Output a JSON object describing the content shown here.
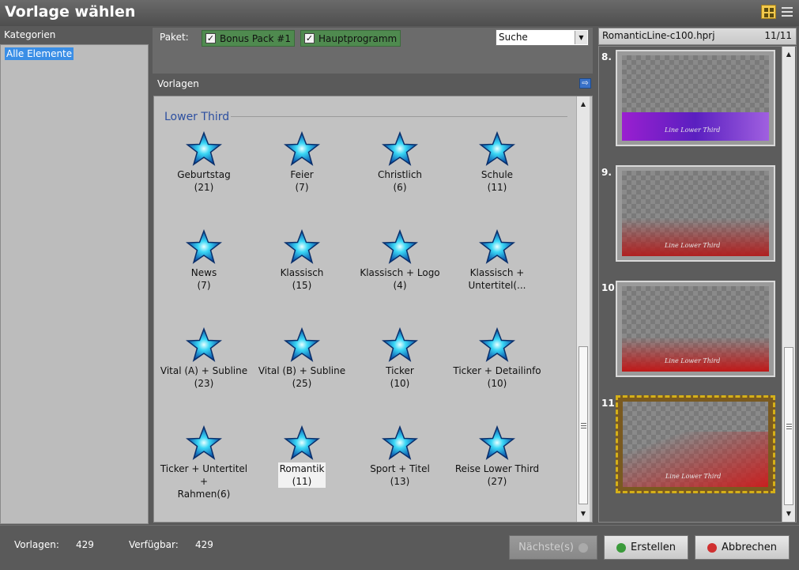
{
  "window": {
    "title": "Vorlage wählen"
  },
  "view_toggle": {
    "grid_icon": "grid-view-icon",
    "list_icon": "list-view-icon"
  },
  "categories": {
    "header": "Kategorien",
    "items": [
      {
        "label": "Alle Elemente",
        "selected": true
      }
    ]
  },
  "filter": {
    "paket_label": "Paket:",
    "packages": [
      {
        "label": "Bonus Pack #1",
        "checked": true
      },
      {
        "label": "Hauptprogramm",
        "checked": true
      }
    ],
    "search_value": "Suche"
  },
  "templates": {
    "header": "Vorlagen",
    "section": "Lower Third",
    "items": [
      {
        "name": "Geburtstag",
        "count": "(21)"
      },
      {
        "name": "Feier",
        "count": "(7)"
      },
      {
        "name": "Christlich",
        "count": "(6)"
      },
      {
        "name": "Schule",
        "count": "(11)"
      },
      {
        "name": "News",
        "count": "(7)"
      },
      {
        "name": "Klassisch",
        "count": "(15)"
      },
      {
        "name": "Klassisch + Logo",
        "count": "(4)"
      },
      {
        "name": "Klassisch +",
        "count": "Untertitel(..."
      },
      {
        "name": "Vital (A) + Subline",
        "count": "(23)"
      },
      {
        "name": "Vital (B) + Subline",
        "count": "(25)"
      },
      {
        "name": "Ticker",
        "count": "(10)"
      },
      {
        "name": "Ticker + Detailinfo",
        "count": "(10)"
      },
      {
        "name": "Ticker + Untertitel +",
        "count": "Rahmen(6)"
      },
      {
        "name": "Romantik",
        "count": "(11)",
        "selected": true
      },
      {
        "name": "Sport + Titel",
        "count": "(13)"
      },
      {
        "name": "Reise Lower Third",
        "count": "(27)"
      }
    ]
  },
  "preview": {
    "file": "RomanticLine-c100.hprj",
    "position": "11/11",
    "items": [
      {
        "num": "8.",
        "caption": "Line Lower Third"
      },
      {
        "num": "9.",
        "caption": "Line Lower Third"
      },
      {
        "num": "10.",
        "caption": "Line Lower Third"
      },
      {
        "num": "11.",
        "caption": "Line Lower Third",
        "selected": true
      }
    ]
  },
  "footer": {
    "vorlagen_label": "Vorlagen:",
    "vorlagen_value": "429",
    "verfuegbar_label": "Verfügbar:",
    "verfuegbar_value": "429",
    "next_label": "Nächste(s)",
    "create_label": "Erstellen",
    "cancel_label": "Abbrechen"
  },
  "colors": {
    "accent": "#3a8ee6",
    "package_bg": "#4f8a4f",
    "section_title": "#2c4fa0",
    "selection_border": "#d5b018"
  }
}
